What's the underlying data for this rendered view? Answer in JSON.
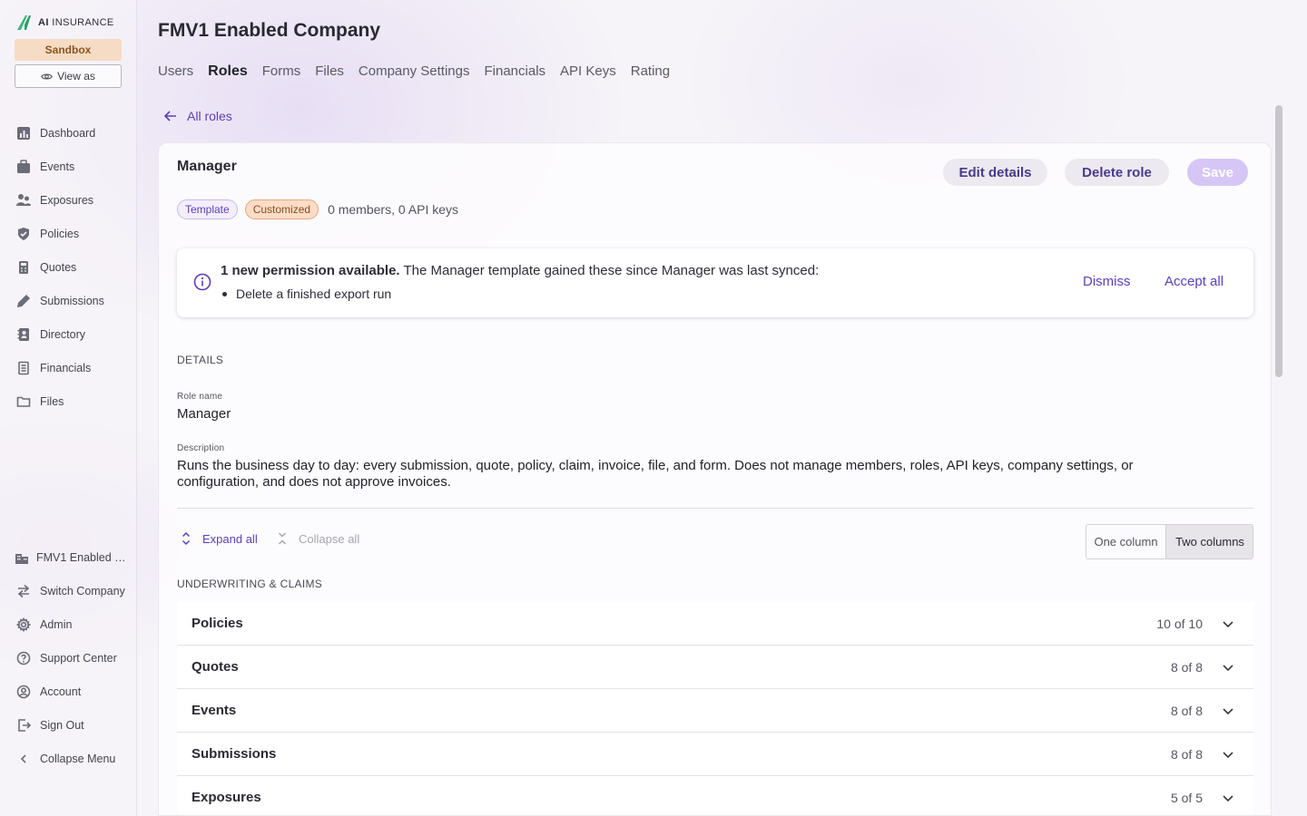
{
  "brand": {
    "logo_prefix": "AI",
    "logo_suffix": "INSURANCE",
    "sandbox_label": "Sandbox",
    "view_as_label": "View as",
    "accent": "#5b3fb8"
  },
  "sidebar": {
    "items": [
      {
        "label": "Dashboard",
        "icon": "chart-icon"
      },
      {
        "label": "Events",
        "icon": "briefcase-icon"
      },
      {
        "label": "Exposures",
        "icon": "people-icon"
      },
      {
        "label": "Policies",
        "icon": "shield-icon"
      },
      {
        "label": "Quotes",
        "icon": "calculator-icon"
      },
      {
        "label": "Submissions",
        "icon": "pen-icon"
      },
      {
        "label": "Directory",
        "icon": "contacts-icon"
      },
      {
        "label": "Financials",
        "icon": "ledger-icon"
      },
      {
        "label": "Files",
        "icon": "folder-icon"
      }
    ],
    "bottom": [
      {
        "label": "FMV1 Enabled …",
        "icon": "building-icon"
      },
      {
        "label": "Switch Company",
        "icon": "switch-icon"
      },
      {
        "label": "Admin",
        "icon": "gear-icon"
      },
      {
        "label": "Support Center",
        "icon": "help-icon"
      },
      {
        "label": "Account",
        "icon": "user-icon"
      },
      {
        "label": "Sign Out",
        "icon": "signout-icon"
      },
      {
        "label": "Collapse Menu",
        "icon": "chevron-left-icon"
      }
    ]
  },
  "header": {
    "company_title": "FMV1 Enabled Company",
    "tabs": [
      "Users",
      "Roles",
      "Forms",
      "Files",
      "Company Settings",
      "Financials",
      "API Keys",
      "Rating"
    ],
    "active_tab": "Roles"
  },
  "back_link": "All roles",
  "role": {
    "title": "Manager",
    "buttons": {
      "edit": "Edit details",
      "delete": "Delete role",
      "save": "Save"
    },
    "badges": {
      "template": "Template",
      "customized": "Customized"
    },
    "members": "0 members, 0 API keys"
  },
  "alert": {
    "bold": "1 new permission available.",
    "text": " The Manager template gained these since Manager was last synced:",
    "items": [
      "Delete a finished export run"
    ],
    "dismiss": "Dismiss",
    "accept": "Accept all"
  },
  "details": {
    "section": "DETAILS",
    "role_name_label": "Role name",
    "role_name_value": "Manager",
    "description_label": "Description",
    "description_value": "Runs the business day to day: every submission, quote, policy, claim, invoice, file, and form. Does not manage members, roles, API keys, company settings, or configuration, and does not approve invoices."
  },
  "controls": {
    "expand_all": "Expand all",
    "collapse_all": "Collapse all",
    "one_column": "One column",
    "two_columns": "Two columns",
    "selected_layout": "Two columns"
  },
  "permissions": {
    "section": "UNDERWRITING & CLAIMS",
    "groups": [
      {
        "name": "Policies",
        "count": "10 of 10"
      },
      {
        "name": "Quotes",
        "count": "8 of 8"
      },
      {
        "name": "Events",
        "count": "8 of 8"
      },
      {
        "name": "Submissions",
        "count": "8 of 8"
      },
      {
        "name": "Exposures",
        "count": "5 of 5"
      }
    ]
  }
}
